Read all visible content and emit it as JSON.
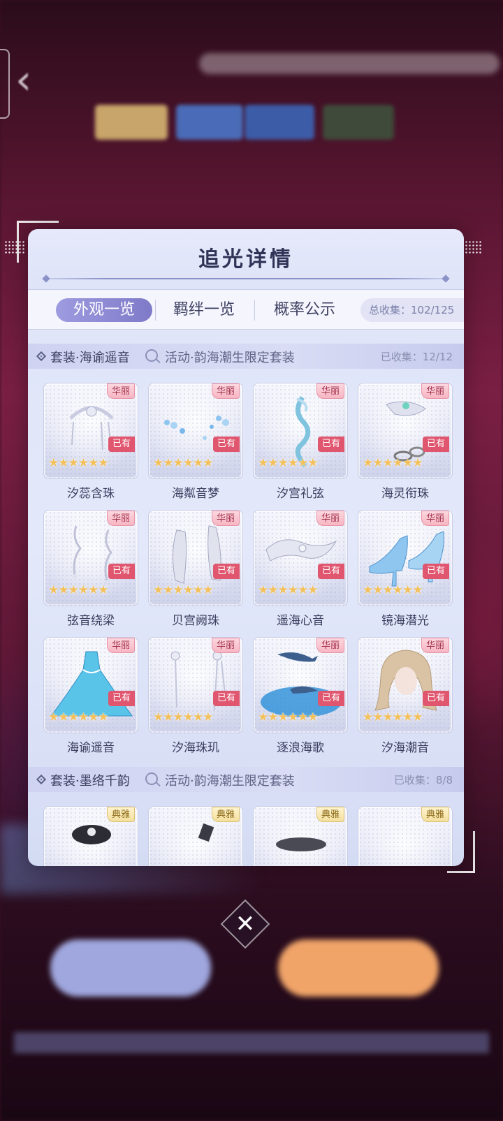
{
  "modal": {
    "title": "追光详情",
    "tabs": [
      {
        "label": "外观一览",
        "active": true
      },
      {
        "label": "羁绊一览",
        "active": false
      },
      {
        "label": "概率公示",
        "active": false
      }
    ],
    "total_collect": "总收集：102/125"
  },
  "sections": [
    {
      "name": "套装·海谕遥音",
      "activity": "活动·韵海潮生限定套装",
      "count": "已收集：12/12",
      "items": [
        {
          "name": "汐蕊含珠",
          "rarity": "华丽",
          "owned": "已有"
        },
        {
          "name": "海粼音梦",
          "rarity": "华丽",
          "owned": "已有"
        },
        {
          "name": "汐宫礼弦",
          "rarity": "华丽",
          "owned": "已有"
        },
        {
          "name": "海灵衔珠",
          "rarity": "华丽",
          "owned": "已有"
        },
        {
          "name": "弦音绕梁",
          "rarity": "华丽",
          "owned": "已有"
        },
        {
          "name": "贝宫阙珠",
          "rarity": "华丽",
          "owned": "已有"
        },
        {
          "name": "遥海心音",
          "rarity": "华丽",
          "owned": "已有"
        },
        {
          "name": "镜海潜光",
          "rarity": "华丽",
          "owned": "已有"
        },
        {
          "name": "海谕遥音",
          "rarity": "华丽",
          "owned": "已有"
        },
        {
          "name": "汐海珠玑",
          "rarity": "华丽",
          "owned": "已有"
        },
        {
          "name": "逐浪海歌",
          "rarity": "华丽",
          "owned": "已有"
        },
        {
          "name": "汐海潮音",
          "rarity": "华丽",
          "owned": "已有"
        }
      ]
    },
    {
      "name": "套装·墨络千韵",
      "activity": "活动·韵海潮生限定套装",
      "count": "已收集：8/8",
      "items": [
        {
          "rarity": "典雅"
        },
        {
          "rarity": "典雅"
        },
        {
          "rarity": "典雅"
        },
        {
          "rarity": "典雅"
        }
      ]
    }
  ],
  "stars": "★★★★★★",
  "close_symbol": "✕",
  "back_symbol": "‹",
  "colors": {
    "tab_active": "#8a86d4",
    "owned_badge": "#e0566f",
    "rarity_luxe": "#f6b6c3",
    "rarity_elegant": "#f4df9d",
    "star": "#f3c05a"
  }
}
